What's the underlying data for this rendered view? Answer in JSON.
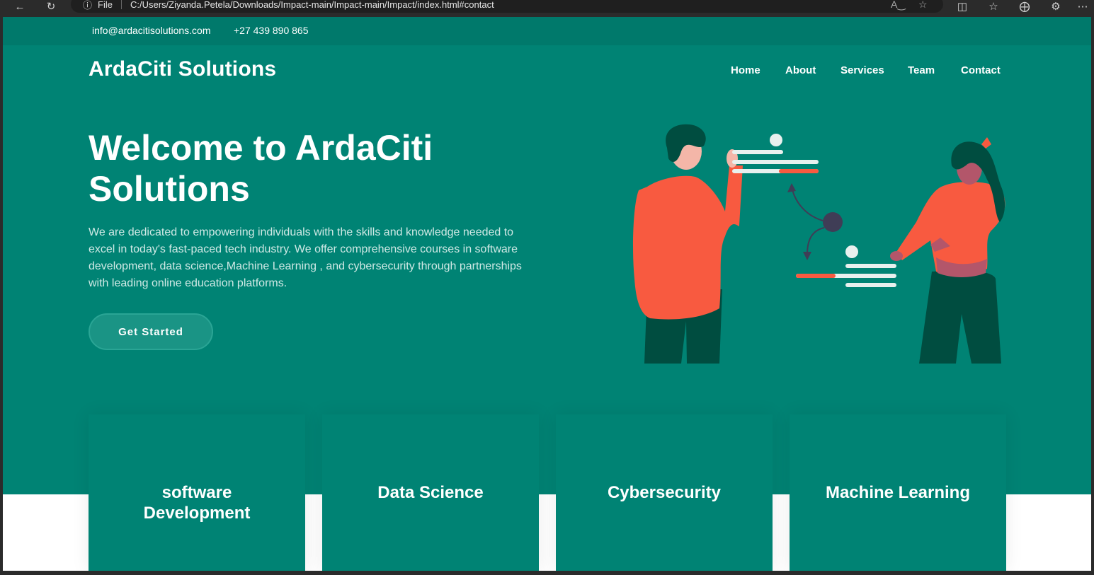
{
  "browser": {
    "file_label": "File",
    "url": "C:/Users/Ziyanda.Petela/Downloads/Impact-main/Impact-main/Impact/index.html#contact"
  },
  "topbar": {
    "email": "info@ardacitisolutions.com",
    "phone": "+27 439 890 865"
  },
  "header": {
    "logo": "ArdaCiti Solutions",
    "nav": [
      "Home",
      "About",
      "Services",
      "Team",
      "Contact"
    ]
  },
  "hero": {
    "title": "Welcome to ArdaCiti Solutions",
    "text": "We are dedicated to empowering individuals with the skills and knowledge needed to excel in today's fast-paced tech industry. We offer comprehensive courses in software development, data science,Machine Learning , and cybersecurity through partnerships with leading online education platforms.",
    "cta": "Get Started"
  },
  "cards": [
    {
      "title": "software Development"
    },
    {
      "title": "Data Science"
    },
    {
      "title": "Cybersecurity"
    },
    {
      "title": "Machine Learning"
    }
  ],
  "colors": {
    "brand": "#008374",
    "topbar": "#00796b",
    "accent": "#f85a40",
    "dark_green": "#004d40"
  },
  "icons": [
    "back-icon",
    "refresh-icon",
    "info-icon",
    "read-aloud-icon",
    "favorite-star-icon",
    "split-screen-icon",
    "favorites-icon",
    "collections-icon",
    "extensions-icon",
    "more-icon"
  ]
}
